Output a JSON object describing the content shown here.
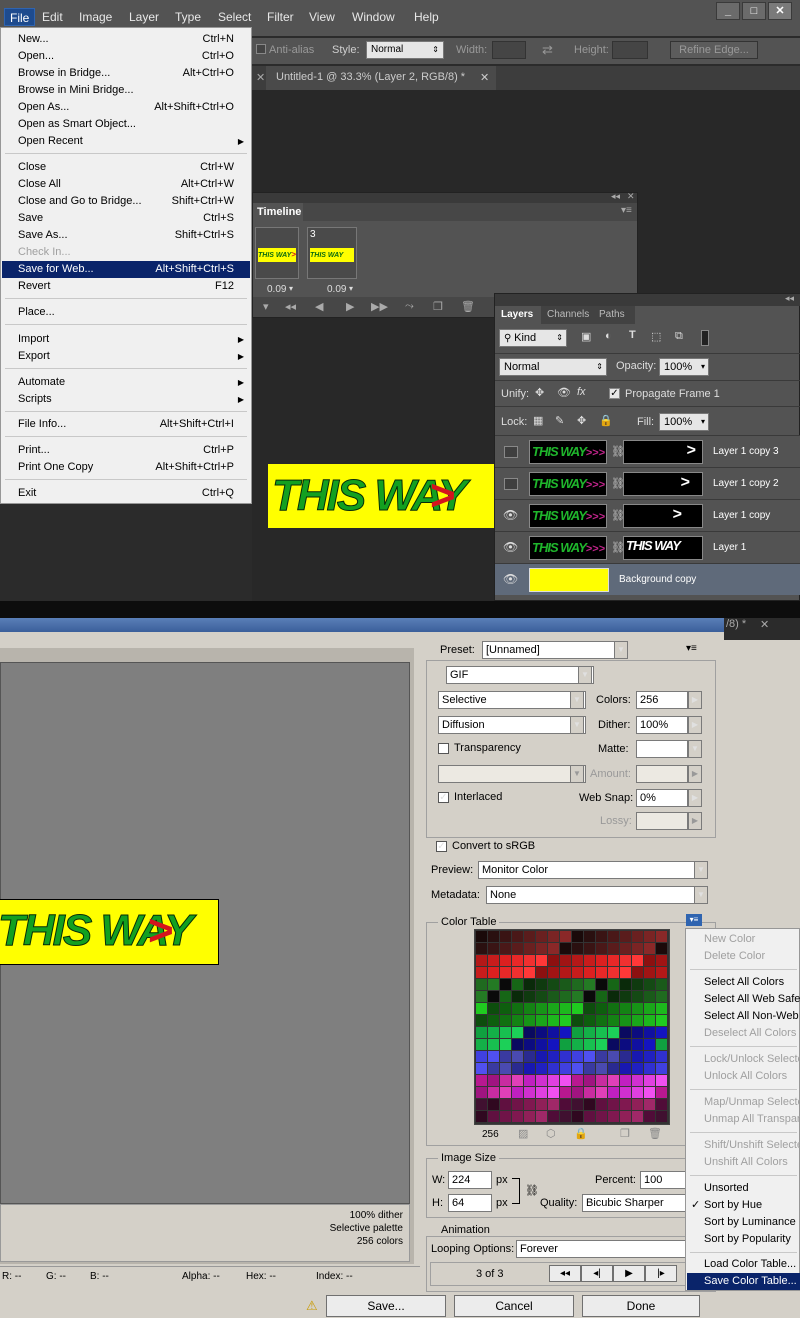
{
  "menubar": {
    "items": [
      "File",
      "Edit",
      "Image",
      "Layer",
      "Type",
      "Select",
      "Filter",
      "View",
      "Window",
      "Help"
    ],
    "window_controls": [
      "_",
      "□",
      "✕"
    ]
  },
  "options_bar": {
    "antialias": "Anti-alias",
    "style_label": "Style:",
    "style_value": "Normal",
    "width_label": "Width:",
    "height_label": "Height:",
    "refine": "Refine Edge..."
  },
  "document_tab": {
    "close_left": "✕",
    "title": "Untitled-1 @ 33.3% (Layer 2, RGB/8) *",
    "close": "✕"
  },
  "file_menu": {
    "items": [
      {
        "label": "New...",
        "shortcut": "Ctrl+N"
      },
      {
        "label": "Open...",
        "shortcut": "Ctrl+O"
      },
      {
        "label": "Browse in Bridge...",
        "shortcut": "Alt+Ctrl+O"
      },
      {
        "label": "Browse in Mini Bridge...",
        "shortcut": ""
      },
      {
        "label": "Open As...",
        "shortcut": "Alt+Shift+Ctrl+O"
      },
      {
        "label": "Open as Smart Object...",
        "shortcut": ""
      },
      {
        "label": "Open Recent",
        "shortcut": ""
      },
      {
        "label": "Close",
        "shortcut": "Ctrl+W"
      },
      {
        "label": "Close All",
        "shortcut": "Alt+Ctrl+W"
      },
      {
        "label": "Close and Go to Bridge...",
        "shortcut": "Shift+Ctrl+W"
      },
      {
        "label": "Save",
        "shortcut": "Ctrl+S"
      },
      {
        "label": "Save As...",
        "shortcut": "Shift+Ctrl+S"
      },
      {
        "label": "Check In...",
        "shortcut": ""
      },
      {
        "label": "Save for Web...",
        "shortcut": "Alt+Shift+Ctrl+S"
      },
      {
        "label": "Revert",
        "shortcut": "F12"
      },
      {
        "label": "Place...",
        "shortcut": ""
      },
      {
        "label": "Import",
        "shortcut": ""
      },
      {
        "label": "Export",
        "shortcut": ""
      },
      {
        "label": "Automate",
        "shortcut": ""
      },
      {
        "label": "Scripts",
        "shortcut": ""
      },
      {
        "label": "File Info...",
        "shortcut": "Alt+Shift+Ctrl+I"
      },
      {
        "label": "Print...",
        "shortcut": "Ctrl+P"
      },
      {
        "label": "Print One Copy",
        "shortcut": "Alt+Shift+Ctrl+P"
      },
      {
        "label": "Exit",
        "shortcut": "Ctrl+Q"
      }
    ],
    "submenu_arrow": "▶"
  },
  "timeline": {
    "title": "Timeline",
    "frame_number": "3",
    "frame_delay_1": "0.09",
    "frame_delay_2": "0.09",
    "frame_text": "THIS WAY",
    "frame_arrow": ">"
  },
  "layers_panel": {
    "tabs": [
      "Layers",
      "Channels",
      "Paths"
    ],
    "kind": "Kind",
    "blend": "Normal",
    "opacity_label": "Opacity:",
    "opacity": "100%",
    "unify_label": "Unify:",
    "propagate": "Propagate Frame 1",
    "lock_label": "Lock:",
    "fill_label": "Fill:",
    "fill": "100%",
    "thumb_text": "THIS WAY",
    "thumb_arrows": ">>>",
    "mask_arrow": ">",
    "mask_text": "THIS WAY",
    "layers": [
      "Layer 1 copy 3",
      "Layer 1 copy 2",
      "Layer 1 copy",
      "Layer 1",
      "Background copy"
    ]
  },
  "canvas_sign": {
    "text": "THIS WAY",
    "arrow": ">"
  },
  "save_for_web": {
    "tab_fragment": "/8) *",
    "tab_fragment_close": "✕",
    "preset_label": "Preset:",
    "preset_value": "[Unnamed]",
    "format": "GIF",
    "reduction": "Selective",
    "colors_label": "Colors:",
    "colors": "256",
    "dither_algo": "Diffusion",
    "dither_label": "Dither:",
    "dither": "100%",
    "transparency": "Transparency",
    "matte_label": "Matte:",
    "amount_label": "Amount:",
    "interlaced": "Interlaced",
    "websnap_label": "Web Snap:",
    "websnap": "0%",
    "lossy_label": "Lossy:",
    "convert_srgb": "Convert to sRGB",
    "preview_label": "Preview:",
    "preview_value": "Monitor Color",
    "metadata_label": "Metadata:",
    "metadata_value": "None",
    "color_table_label": "Color Table",
    "color_count": "256",
    "image_size_label": "Image Size",
    "w_label": "W:",
    "w_value": "224",
    "h_label": "H:",
    "h_value": "64",
    "px": "px",
    "percent_label": "Percent:",
    "percent": "100",
    "quality_label": "Quality:",
    "quality": "Bicubic Sharper",
    "animation_label": "Animation",
    "looping_label": "Looping Options:",
    "looping": "Forever",
    "frame_counter": "3 of 3",
    "info_dither": "100% dither",
    "info_palette": "Selective palette",
    "info_colors": "256 colors",
    "status_r": "R: --",
    "status_g": "G: --",
    "status_b": "B: --",
    "status_alpha": "Alpha: --",
    "status_hex": "Hex: --",
    "status_index": "Index: --",
    "save_btn": "Save...",
    "cancel_btn": "Cancel",
    "done_btn": "Done",
    "warning_icon": "⚠",
    "checkmark": "✓"
  },
  "color_table_menu": {
    "items": [
      {
        "label": "New Color",
        "disabled": true
      },
      {
        "label": "Delete Color",
        "disabled": true
      },
      {
        "label": "Select All Colors",
        "disabled": false
      },
      {
        "label": "Select All Web Safe",
        "disabled": false
      },
      {
        "label": "Select All Non-Web Safe",
        "disabled": false
      },
      {
        "label": "Deselect All Colors",
        "disabled": true
      },
      {
        "label": "Lock/Unlock Selected Colors",
        "disabled": true
      },
      {
        "label": "Unlock All Colors",
        "disabled": true
      },
      {
        "label": "Map/Unmap Selected Colors",
        "disabled": true
      },
      {
        "label": "Unmap All Transparent Colors",
        "disabled": true
      },
      {
        "label": "Shift/Unshift Selected Colors",
        "disabled": true
      },
      {
        "label": "Unshift All Colors",
        "disabled": true
      },
      {
        "label": "Unsorted",
        "disabled": false
      },
      {
        "label": "Sort by Hue",
        "disabled": false
      },
      {
        "label": "Sort by Luminance",
        "disabled": false
      },
      {
        "label": "Sort by Popularity",
        "disabled": false
      },
      {
        "label": "Load Color Table...",
        "disabled": false
      },
      {
        "label": "Save Color Table...",
        "disabled": false
      }
    ],
    "checked": "Sort by Hue",
    "selected": "Save Color Table..."
  },
  "colors": {
    "ps_bg": "#2b2b2b",
    "menu_highlight": "#0a246a",
    "sign_yellow": "#ffff00",
    "sign_green": "#13a020",
    "arrow_red": "#d4141e",
    "dialog_bg": "#d4d0c8"
  }
}
